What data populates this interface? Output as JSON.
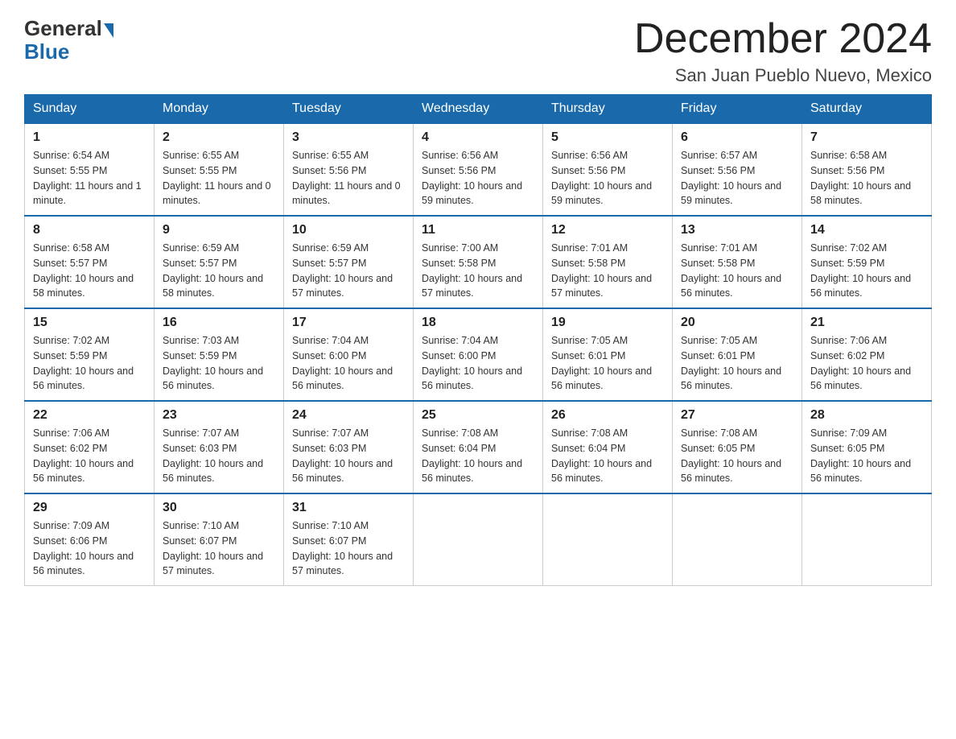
{
  "logo": {
    "general": "General",
    "blue": "Blue"
  },
  "title": "December 2024",
  "location": "San Juan Pueblo Nuevo, Mexico",
  "days_header": [
    "Sunday",
    "Monday",
    "Tuesday",
    "Wednesday",
    "Thursday",
    "Friday",
    "Saturday"
  ],
  "weeks": [
    [
      {
        "num": "1",
        "sunrise": "6:54 AM",
        "sunset": "5:55 PM",
        "daylight": "11 hours and 1 minute."
      },
      {
        "num": "2",
        "sunrise": "6:55 AM",
        "sunset": "5:55 PM",
        "daylight": "11 hours and 0 minutes."
      },
      {
        "num": "3",
        "sunrise": "6:55 AM",
        "sunset": "5:56 PM",
        "daylight": "11 hours and 0 minutes."
      },
      {
        "num": "4",
        "sunrise": "6:56 AM",
        "sunset": "5:56 PM",
        "daylight": "10 hours and 59 minutes."
      },
      {
        "num": "5",
        "sunrise": "6:56 AM",
        "sunset": "5:56 PM",
        "daylight": "10 hours and 59 minutes."
      },
      {
        "num": "6",
        "sunrise": "6:57 AM",
        "sunset": "5:56 PM",
        "daylight": "10 hours and 59 minutes."
      },
      {
        "num": "7",
        "sunrise": "6:58 AM",
        "sunset": "5:56 PM",
        "daylight": "10 hours and 58 minutes."
      }
    ],
    [
      {
        "num": "8",
        "sunrise": "6:58 AM",
        "sunset": "5:57 PM",
        "daylight": "10 hours and 58 minutes."
      },
      {
        "num": "9",
        "sunrise": "6:59 AM",
        "sunset": "5:57 PM",
        "daylight": "10 hours and 58 minutes."
      },
      {
        "num": "10",
        "sunrise": "6:59 AM",
        "sunset": "5:57 PM",
        "daylight": "10 hours and 57 minutes."
      },
      {
        "num": "11",
        "sunrise": "7:00 AM",
        "sunset": "5:58 PM",
        "daylight": "10 hours and 57 minutes."
      },
      {
        "num": "12",
        "sunrise": "7:01 AM",
        "sunset": "5:58 PM",
        "daylight": "10 hours and 57 minutes."
      },
      {
        "num": "13",
        "sunrise": "7:01 AM",
        "sunset": "5:58 PM",
        "daylight": "10 hours and 56 minutes."
      },
      {
        "num": "14",
        "sunrise": "7:02 AM",
        "sunset": "5:59 PM",
        "daylight": "10 hours and 56 minutes."
      }
    ],
    [
      {
        "num": "15",
        "sunrise": "7:02 AM",
        "sunset": "5:59 PM",
        "daylight": "10 hours and 56 minutes."
      },
      {
        "num": "16",
        "sunrise": "7:03 AM",
        "sunset": "5:59 PM",
        "daylight": "10 hours and 56 minutes."
      },
      {
        "num": "17",
        "sunrise": "7:04 AM",
        "sunset": "6:00 PM",
        "daylight": "10 hours and 56 minutes."
      },
      {
        "num": "18",
        "sunrise": "7:04 AM",
        "sunset": "6:00 PM",
        "daylight": "10 hours and 56 minutes."
      },
      {
        "num": "19",
        "sunrise": "7:05 AM",
        "sunset": "6:01 PM",
        "daylight": "10 hours and 56 minutes."
      },
      {
        "num": "20",
        "sunrise": "7:05 AM",
        "sunset": "6:01 PM",
        "daylight": "10 hours and 56 minutes."
      },
      {
        "num": "21",
        "sunrise": "7:06 AM",
        "sunset": "6:02 PM",
        "daylight": "10 hours and 56 minutes."
      }
    ],
    [
      {
        "num": "22",
        "sunrise": "7:06 AM",
        "sunset": "6:02 PM",
        "daylight": "10 hours and 56 minutes."
      },
      {
        "num": "23",
        "sunrise": "7:07 AM",
        "sunset": "6:03 PM",
        "daylight": "10 hours and 56 minutes."
      },
      {
        "num": "24",
        "sunrise": "7:07 AM",
        "sunset": "6:03 PM",
        "daylight": "10 hours and 56 minutes."
      },
      {
        "num": "25",
        "sunrise": "7:08 AM",
        "sunset": "6:04 PM",
        "daylight": "10 hours and 56 minutes."
      },
      {
        "num": "26",
        "sunrise": "7:08 AM",
        "sunset": "6:04 PM",
        "daylight": "10 hours and 56 minutes."
      },
      {
        "num": "27",
        "sunrise": "7:08 AM",
        "sunset": "6:05 PM",
        "daylight": "10 hours and 56 minutes."
      },
      {
        "num": "28",
        "sunrise": "7:09 AM",
        "sunset": "6:05 PM",
        "daylight": "10 hours and 56 minutes."
      }
    ],
    [
      {
        "num": "29",
        "sunrise": "7:09 AM",
        "sunset": "6:06 PM",
        "daylight": "10 hours and 56 minutes."
      },
      {
        "num": "30",
        "sunrise": "7:10 AM",
        "sunset": "6:07 PM",
        "daylight": "10 hours and 57 minutes."
      },
      {
        "num": "31",
        "sunrise": "7:10 AM",
        "sunset": "6:07 PM",
        "daylight": "10 hours and 57 minutes."
      },
      null,
      null,
      null,
      null
    ]
  ]
}
